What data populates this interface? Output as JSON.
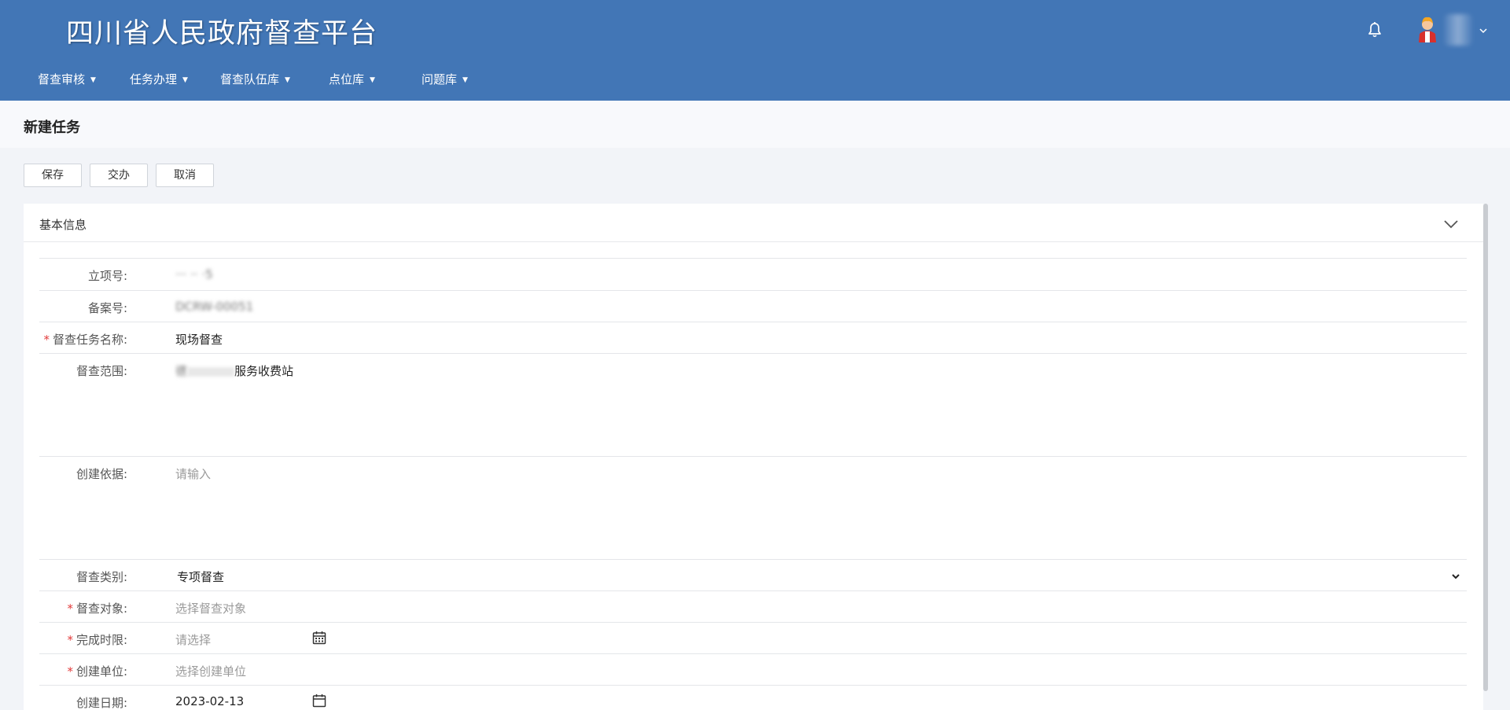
{
  "header": {
    "app_title": "四川省人民政府督查平台",
    "nav": [
      {
        "label": "督查审核"
      },
      {
        "label": "任务办理"
      },
      {
        "label": "督查队伍库"
      },
      {
        "label": "点位库"
      },
      {
        "label": "问题库"
      }
    ],
    "icons": {
      "notification": "bell-icon",
      "user": "avatar-icon",
      "dropdown": "chevron-down-icon"
    }
  },
  "page": {
    "title": "新建任务"
  },
  "toolbar": {
    "save_label": "保存",
    "assign_label": "交办",
    "cancel_label": "取消"
  },
  "section": {
    "title": "基本信息"
  },
  "form": {
    "project_no": {
      "label": "立项号:",
      "value": "··· ·· ·5"
    },
    "record_no": {
      "label": "备案号:",
      "value": "DCRW-00051"
    },
    "task_name": {
      "label": "督查任务名称:",
      "value": "现场督查"
    },
    "scope": {
      "label": "督查范围:",
      "value_blurred": "德",
      "value_visible": "服务收费站"
    },
    "basis": {
      "label": "创建依据:",
      "placeholder": "请输入"
    },
    "category": {
      "label": "督查类别:",
      "value": "专项督查"
    },
    "target": {
      "label": "督查对象:",
      "placeholder": "选择督查对象"
    },
    "deadline": {
      "label": "完成时限:",
      "placeholder": "请选择"
    },
    "creator_unit": {
      "label": "创建单位:",
      "placeholder": "选择创建单位"
    },
    "created_date": {
      "label": "创建日期:",
      "value": "2023-02-13"
    }
  },
  "colors": {
    "header_bg": "#4276b6",
    "required": "#e23b3b",
    "page_bg": "#f2f4f8"
  }
}
